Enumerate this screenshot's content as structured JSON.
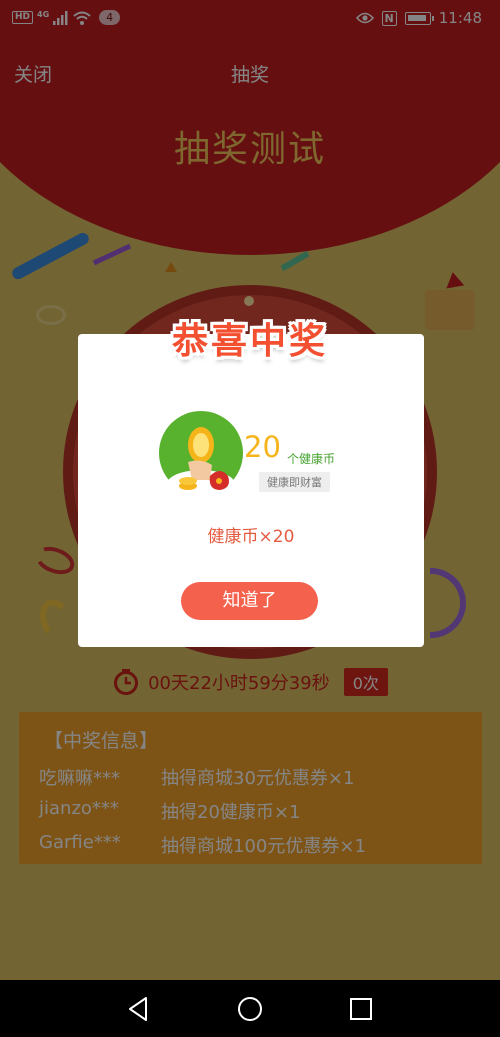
{
  "status_bar": {
    "hd": "HD",
    "network": "4G",
    "notif_count": "4",
    "nfc": "N",
    "time": "11:48"
  },
  "navbar": {
    "close_label": "关闭",
    "title": "抽奖"
  },
  "hero": {
    "title": "抽奖测试"
  },
  "countdown": {
    "text": "00天22小时59分39秒",
    "remaining_draws": "0次"
  },
  "winners": {
    "title": "【中奖信息】",
    "rows": [
      {
        "user": "吃嘛嘛***",
        "prize": "抽得商城30元优惠券×1"
      },
      {
        "user": "jianzo***",
        "prize": "抽得20健康币×1"
      },
      {
        "user": "Garfie***",
        "prize": "抽得商城100元优惠券×1"
      }
    ]
  },
  "modal": {
    "banner": "恭喜中奖",
    "amount": "20",
    "unit": "个健康币",
    "slogan": "健康即财富",
    "result": "健康币×20",
    "ok_label": "知道了"
  },
  "colors": {
    "primary_red": "#c41e22",
    "accent_orange": "#f4614c",
    "coin_gold": "#f6b41b",
    "green": "#46a330",
    "winners_bg": "#f2a22b"
  },
  "icons": [
    "eye-icon",
    "wifi-icon",
    "signal-icon",
    "battery-icon",
    "timer-icon",
    "health-coin-icon",
    "back-icon",
    "home-icon",
    "recents-icon"
  ]
}
